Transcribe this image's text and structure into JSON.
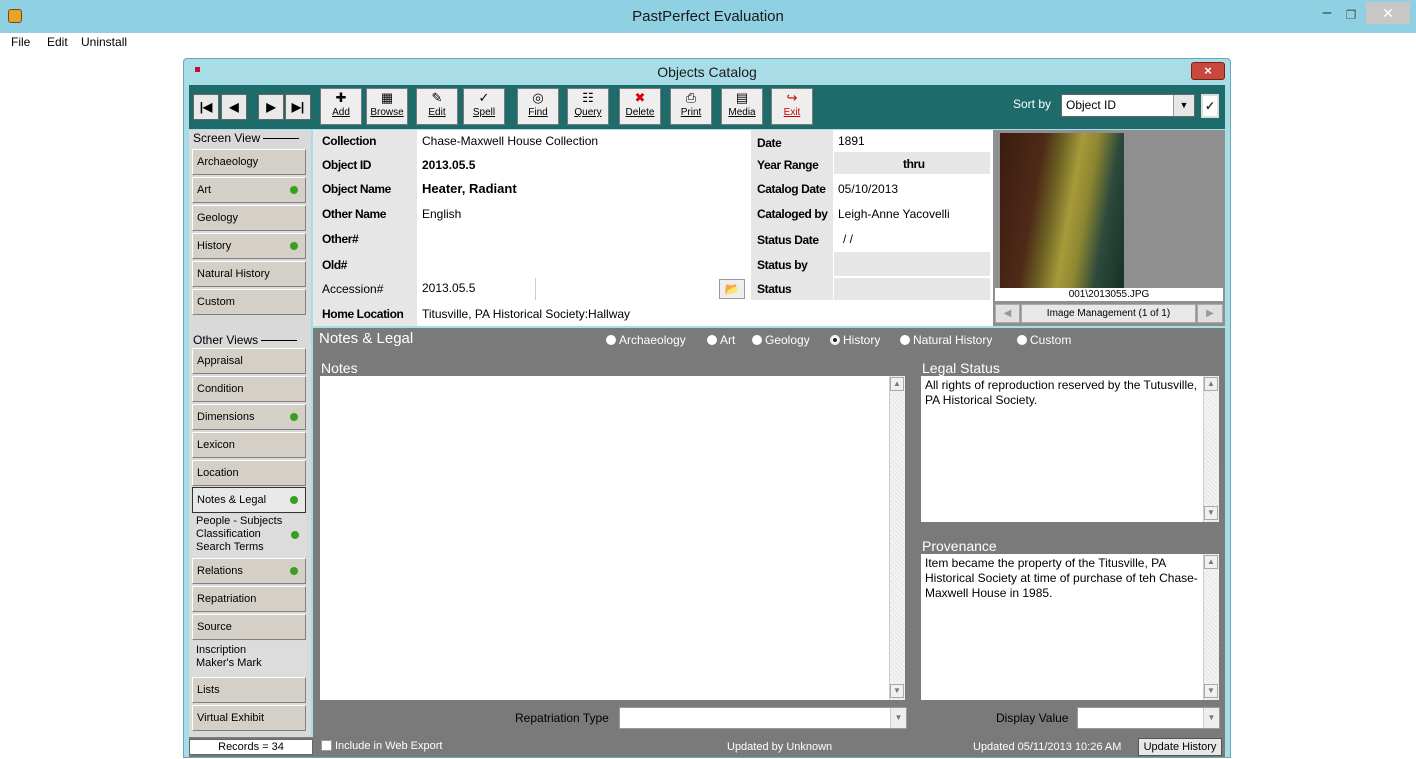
{
  "app": {
    "title": "PastPerfect Evaluation",
    "menu": [
      "File",
      "Edit",
      "Uninstall"
    ]
  },
  "window": {
    "title": "Objects Catalog",
    "close": "×"
  },
  "toolbar": {
    "nav": [
      "|◀",
      "◀",
      "▶",
      "▶|"
    ],
    "buttons": [
      {
        "label": "Add",
        "icon": "add-icon",
        "glyph": "✚"
      },
      {
        "label": "Browse",
        "icon": "browse-icon",
        "glyph": "▦"
      },
      {
        "label": "Edit",
        "icon": "edit-icon",
        "glyph": "✎"
      },
      {
        "label": "Spell",
        "icon": "spell-icon",
        "glyph": "✓"
      },
      {
        "label": "Find",
        "icon": "binoculars-icon",
        "glyph": "◎"
      },
      {
        "label": "Query",
        "icon": "query-icon",
        "glyph": "☷"
      },
      {
        "label": "Delete",
        "icon": "delete-icon",
        "glyph": "✖"
      },
      {
        "label": "Print",
        "icon": "printer-icon",
        "glyph": "⎙"
      },
      {
        "label": "Media",
        "icon": "film-icon",
        "glyph": "▤"
      },
      {
        "label": "Exit",
        "icon": "exit-icon",
        "glyph": "↪"
      }
    ],
    "sort_label": "Sort by",
    "sort_value": "Object ID"
  },
  "left_panel": {
    "screen_view_head": "Screen View",
    "screen_view": [
      {
        "label": "Archaeology",
        "dot": false
      },
      {
        "label": "Art",
        "dot": true
      },
      {
        "label": "Geology",
        "dot": false
      },
      {
        "label": "History",
        "dot": true
      },
      {
        "label": "Natural History",
        "dot": false
      },
      {
        "label": "Custom",
        "dot": false
      }
    ],
    "other_views_head": "Other Views",
    "other_views": [
      {
        "label": "Appraisal",
        "dot": false
      },
      {
        "label": "Condition",
        "dot": false
      },
      {
        "label": "Dimensions",
        "dot": true
      },
      {
        "label": "Lexicon",
        "dot": false
      },
      {
        "label": "Location",
        "dot": false
      },
      {
        "label": "Notes & Legal",
        "dot": true
      },
      {
        "label": "People - Subjects",
        "dot": false
      },
      {
        "label": "Classification",
        "dot": true
      },
      {
        "label": "Search Terms",
        "dot": false
      },
      {
        "label": "Relations",
        "dot": true
      },
      {
        "label": "Repatriation",
        "dot": false
      },
      {
        "label": "Source",
        "dot": false
      },
      {
        "label": "Inscription",
        "dot": false
      },
      {
        "label": "Maker's Mark",
        "dot": false
      },
      {
        "label": "Lists",
        "dot": false
      },
      {
        "label": "Virtual Exhibit",
        "dot": false
      }
    ]
  },
  "fields": {
    "collection_label": "Collection",
    "collection": "Chase-Maxwell House Collection",
    "object_id_label": "Object ID",
    "object_id": "2013.05.5",
    "object_name_label": "Object Name",
    "object_name": "Heater, Radiant",
    "other_name_label": "Other Name",
    "other_name": "English",
    "other_num_label": "Other#",
    "other_num": "",
    "old_num_label": "Old#",
    "old_num": "",
    "accession_label": "Accession#",
    "accession": "2013.05.5",
    "home_location_label": "Home Location",
    "home_location": "Titusville, PA Historical Society:Hallway",
    "date_label": "Date",
    "date": "1891",
    "year_range_label": "Year Range",
    "year_range_thru": "thru",
    "catalog_date_label": "Catalog Date",
    "catalog_date": "05/10/2013",
    "cataloged_by_label": "Cataloged by",
    "cataloged_by": "Leigh-Anne Yacovelli",
    "status_date_label": "Status Date",
    "status_date": "/ /",
    "status_by_label": "Status by",
    "status_by": "",
    "status_label": "Status",
    "status": ""
  },
  "image": {
    "filename": "001\\2013055.JPG",
    "management": "Image Management (1 of 1)"
  },
  "notes_legal": {
    "title": "Notes & Legal",
    "views": [
      {
        "label": "Archaeology",
        "selected": false
      },
      {
        "label": "Art",
        "selected": false
      },
      {
        "label": "Geology",
        "selected": false
      },
      {
        "label": "History",
        "selected": true
      },
      {
        "label": "Natural History",
        "selected": false
      },
      {
        "label": "Custom",
        "selected": false
      }
    ],
    "notes_label": "Notes",
    "notes": "",
    "legal_status_label": "Legal Status",
    "legal_status": "All rights of reproduction reserved by the Tutusville, PA Historical Society.",
    "provenance_label": "Provenance",
    "provenance": "Item became the property of the Titusville, PA Historical Society at time of purchase of teh Chase-Maxwell House in 1985.",
    "repatriation_type_label": "Repatriation Type",
    "display_value_label": "Display Value"
  },
  "status_bar": {
    "records": "Records = 34",
    "web_export": "Include in Web Export",
    "updated_by": "Updated by  Unknown",
    "updated": "Updated   05/11/2013 10:26 AM",
    "update_history": "Update History"
  },
  "colors": {
    "titlebar": "#8fd0e3",
    "toolbar": "#1d6b6b",
    "panel_gray": "#7a7a7a",
    "dot_green": "#3a9e1e"
  }
}
